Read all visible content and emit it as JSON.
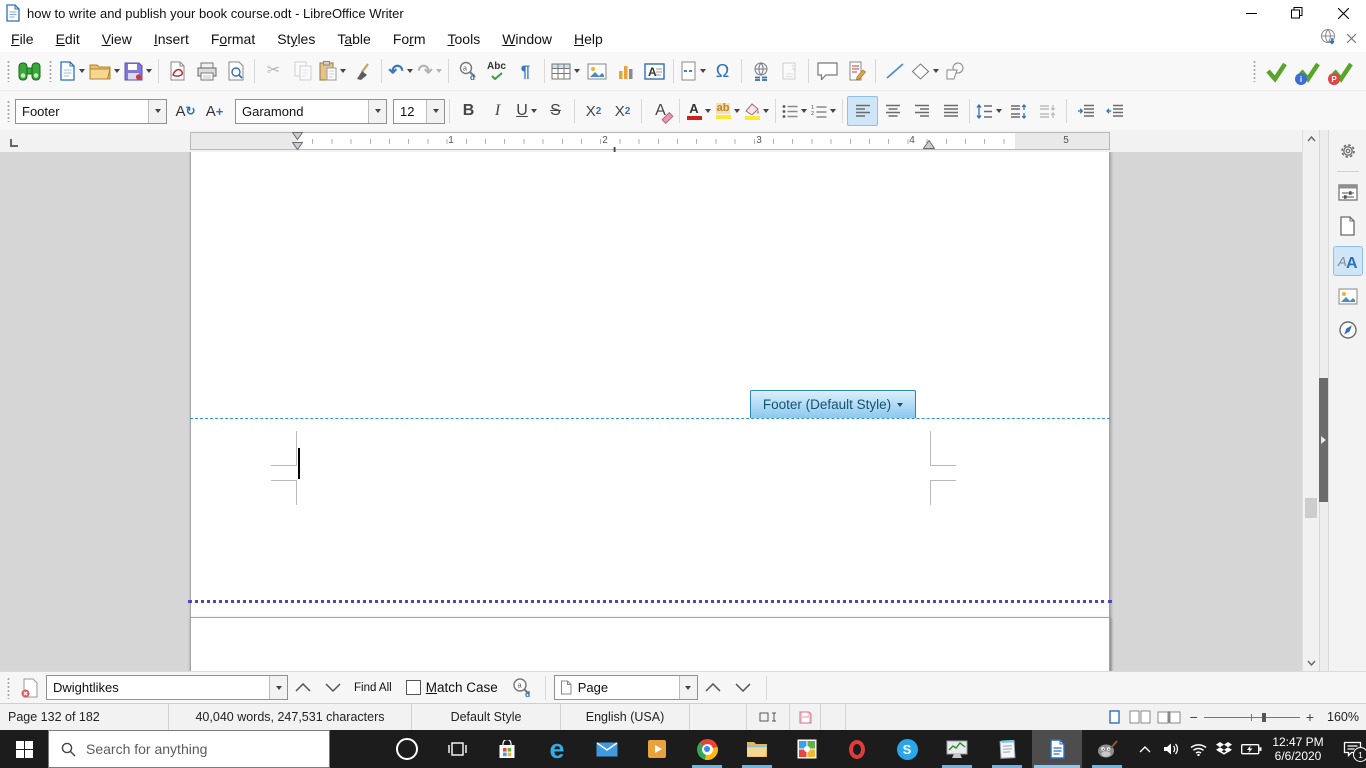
{
  "window": {
    "title": "how to write and publish your book course.odt - LibreOffice Writer"
  },
  "menu": {
    "items": [
      {
        "pre": "",
        "key": "F",
        "post": "ile"
      },
      {
        "pre": "",
        "key": "E",
        "post": "dit"
      },
      {
        "pre": "",
        "key": "V",
        "post": "iew"
      },
      {
        "pre": "",
        "key": "I",
        "post": "nsert"
      },
      {
        "pre": "F",
        "key": "o",
        "post": "rmat"
      },
      {
        "pre": "St",
        "key": "y",
        "post": "les"
      },
      {
        "pre": "T",
        "key": "a",
        "post": "ble"
      },
      {
        "pre": "Fo",
        "key": "r",
        "post": "m"
      },
      {
        "pre": "",
        "key": "T",
        "post": "ools"
      },
      {
        "pre": "",
        "key": "W",
        "post": "indow"
      },
      {
        "pre": "",
        "key": "H",
        "post": "elp"
      }
    ]
  },
  "glyphs": {
    "cut": "✂",
    "undo": "↶",
    "redo": "↷",
    "omega": "Ω",
    "pilcrow": "¶",
    "bold": "B",
    "italic": "I",
    "underline": "U",
    "strike": "S",
    "letter_x": "X",
    "two": "2",
    "letter_a": "A",
    "letters_ab": "ab",
    "spell": "Abc",
    "plus": "+",
    "refresh": "↻",
    "edge_e": "e",
    "skype_s": "S",
    "minus": "−",
    "plus_sign": "+",
    "badge_i": "i",
    "badge_p": "P"
  },
  "formatting": {
    "paragraph_style": "Footer",
    "font_name": "Garamond",
    "font_size": "12"
  },
  "ruler": {
    "numbers": [
      "1",
      "2",
      "3",
      "4",
      "5"
    ]
  },
  "document": {
    "footer_tag": "Footer (Default Style)"
  },
  "find_bar": {
    "query": "Dwightlikes",
    "find_all": "Find All",
    "match_case_key": "M",
    "match_case_rest": "atch Case",
    "scope": "Page"
  },
  "status_bar": {
    "page_info": "Page 132 of 182",
    "word_count": "40,040 words, 247,531 characters",
    "page_style": "Default Style",
    "language": "English (USA)",
    "zoom_level": "160%"
  },
  "taskbar": {
    "search_placeholder": "Search for anything",
    "time": "12:47 PM",
    "date": "6/6/2020",
    "notification_count": "1"
  },
  "icon_names": {
    "standard_toolbar": [
      "find-toolbar-toggle-binoculars",
      "new-document",
      "open",
      "save",
      "export-pdf",
      "print",
      "print-preview",
      "cut",
      "copy",
      "paste",
      "clone-formatting",
      "undo",
      "redo",
      "find-and-replace",
      "spelling",
      "formatting-marks",
      "insert-table",
      "insert-image",
      "insert-chart",
      "insert-text-box",
      "insert-page-break",
      "insert-special-character",
      "insert-hyperlink",
      "insert-footnote",
      "insert-comment",
      "track-changes",
      "insert-line",
      "basic-shapes",
      "show-draw-functions",
      "extension-check",
      "extension-info",
      "extension-p"
    ],
    "formatting_toolbar": [
      "update-style",
      "new-style",
      "bold",
      "italic",
      "underline",
      "strikethrough",
      "superscript",
      "subscript",
      "clear-formatting",
      "font-color",
      "highlighting-color",
      "background-color",
      "unordered-list",
      "ordered-list",
      "align-left",
      "align-center",
      "align-right",
      "justified",
      "line-spacing",
      "increase-paragraph-spacing",
      "decrease-paragraph-spacing",
      "increase-indent",
      "decrease-indent"
    ],
    "sidebar": [
      "sidebar-settings",
      "properties-deck",
      "page-deck",
      "styles-deck",
      "gallery-deck",
      "navigator-deck"
    ],
    "taskbar_apps": [
      "start",
      "search",
      "cortana",
      "task-view",
      "store",
      "edge",
      "mail",
      "movies-tv",
      "chrome",
      "file-explorer",
      "photos",
      "opera",
      "skype",
      "performance-monitor",
      "notepad",
      "libreoffice-writer",
      "gimp"
    ],
    "tray": [
      "hidden-icons",
      "volume",
      "wifi",
      "dropbox",
      "battery",
      "clock",
      "action-center"
    ]
  }
}
